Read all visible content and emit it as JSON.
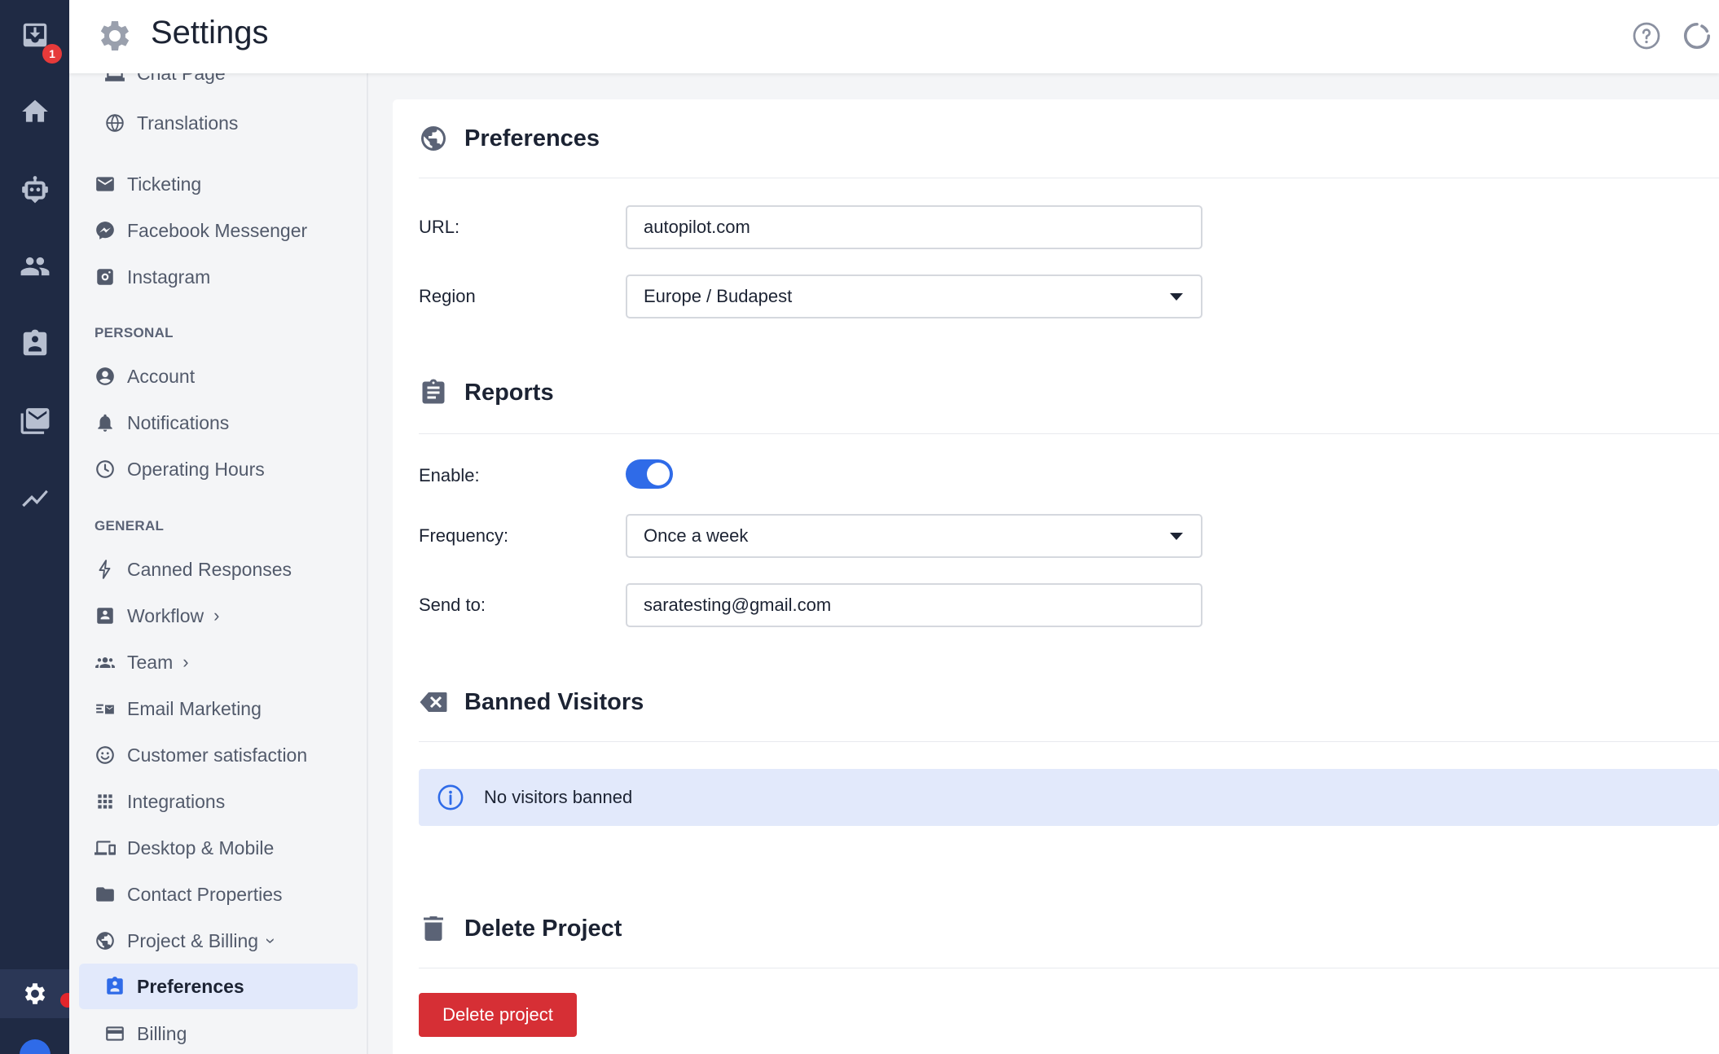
{
  "rail": {
    "badge_count": "1"
  },
  "topbar": {
    "title": "Settings"
  },
  "nav": {
    "partial_item": "Chat Page",
    "translations": "Translations",
    "ticketing": "Ticketing",
    "facebook_messenger": "Facebook Messenger",
    "instagram": "Instagram",
    "section_personal": "PERSONAL",
    "account": "Account",
    "notifications": "Notifications",
    "operating_hours": "Operating Hours",
    "section_general": "GENERAL",
    "canned_responses": "Canned Responses",
    "workflow": "Workflow",
    "team": "Team",
    "email_marketing": "Email Marketing",
    "customer_satisfaction": "Customer satisfaction",
    "integrations": "Integrations",
    "desktop_mobile": "Desktop & Mobile",
    "contact_properties": "Contact Properties",
    "project_billing": "Project & Billing",
    "preferences": "Preferences",
    "billing": "Billing"
  },
  "preferences": {
    "heading": "Preferences",
    "url_label": "URL:",
    "url_value": "autopilot.com",
    "region_label": "Region",
    "region_value": "Europe / Budapest"
  },
  "reports": {
    "heading": "Reports",
    "enable_label": "Enable:",
    "enabled": true,
    "frequency_label": "Frequency:",
    "frequency_value": "Once a week",
    "send_to_label": "Send to:",
    "send_to_value": "saratesting@gmail.com"
  },
  "banned": {
    "heading": "Banned Visitors",
    "empty_message": "No visitors banned"
  },
  "delete": {
    "heading": "Delete Project",
    "button_label": "Delete project"
  },
  "colors": {
    "accent": "#2f6be8",
    "danger": "#d62f35",
    "rail": "#1f2a44",
    "active_bg": "#e2e9fb"
  }
}
